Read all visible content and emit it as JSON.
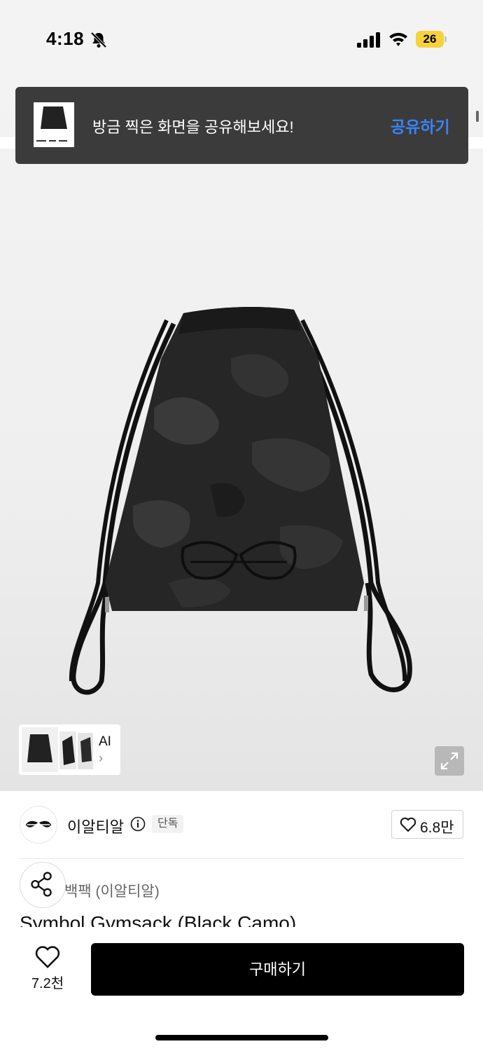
{
  "status_bar": {
    "time": "4:18",
    "battery_level": "26",
    "icons": [
      "bell-slash-icon",
      "signal-icon",
      "wifi-icon",
      "battery-icon"
    ]
  },
  "toast": {
    "message": "방금 찍은 화면을 공유해보세요!",
    "action_label": "공유하기",
    "accent_color": "#3a82f7"
  },
  "gallery": {
    "ai_label": "AI",
    "chevron": "›"
  },
  "brand": {
    "name": "이알티알",
    "badge": "단독",
    "like_count": "6.8만"
  },
  "product": {
    "category": "백팩 (이알티알)",
    "title": "Symbol Gymsack (Black Camo)"
  },
  "bottom_bar": {
    "wish_count": "7.2천",
    "buy_label": "구매하기"
  }
}
